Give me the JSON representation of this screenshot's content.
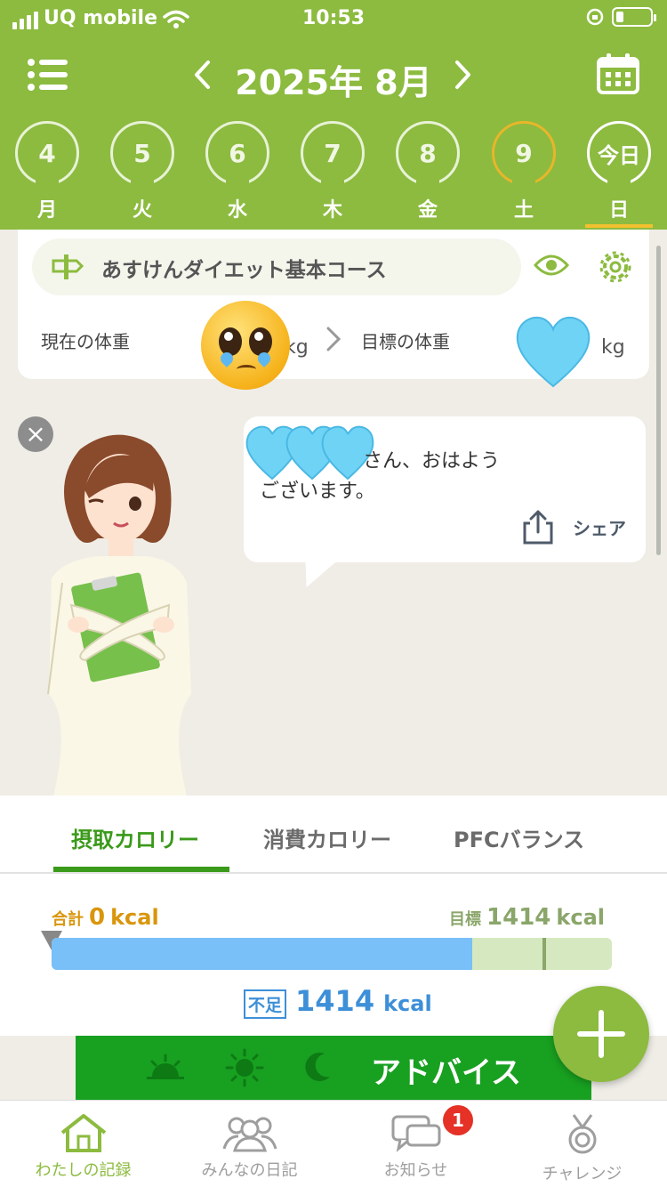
{
  "status_bar": {
    "carrier": "UQ mobile",
    "time": "10:53"
  },
  "header": {
    "month": "2025年 8月",
    "days": [
      {
        "num": "4",
        "weekday": "月"
      },
      {
        "num": "5",
        "weekday": "火"
      },
      {
        "num": "6",
        "weekday": "水"
      },
      {
        "num": "7",
        "weekday": "木"
      },
      {
        "num": "8",
        "weekday": "金"
      },
      {
        "num": "9",
        "weekday": "土"
      },
      {
        "num": "今日",
        "weekday": "日"
      }
    ]
  },
  "course": {
    "name": "あすけんダイエット基本コース",
    "current_weight_label": "現在の体重",
    "target_weight_label": "目標の体重",
    "unit": "kg"
  },
  "bubble": {
    "greeting_line1": "さん、おはよう",
    "greeting_line2": "ございます。",
    "share_label": "シェア"
  },
  "calories": {
    "tabs": [
      "摂取カロリー",
      "消費カロリー",
      "PFCバランス"
    ],
    "total_label": "合計",
    "total_value": "0",
    "target_label": "目標",
    "target_value": "1414",
    "unit": "kcal",
    "deficit_label": "不足",
    "deficit_value": "1414",
    "fill_fraction": 0.75
  },
  "advice": {
    "label": "アドバイス"
  },
  "bottom_nav": [
    {
      "label": "わたしの記録",
      "icon": "house-icon"
    },
    {
      "label": "みんなの日記",
      "icon": "people-icon"
    },
    {
      "label": "お知らせ",
      "icon": "chat-icon"
    },
    {
      "label": "チャレンジ",
      "icon": "medal-icon"
    }
  ],
  "notification_count": "1",
  "colors": {
    "brand_green": "#8cbb3f",
    "advice_green": "#18a020",
    "progress_blue": "#79bff8",
    "saturday": "#e8b62a"
  }
}
